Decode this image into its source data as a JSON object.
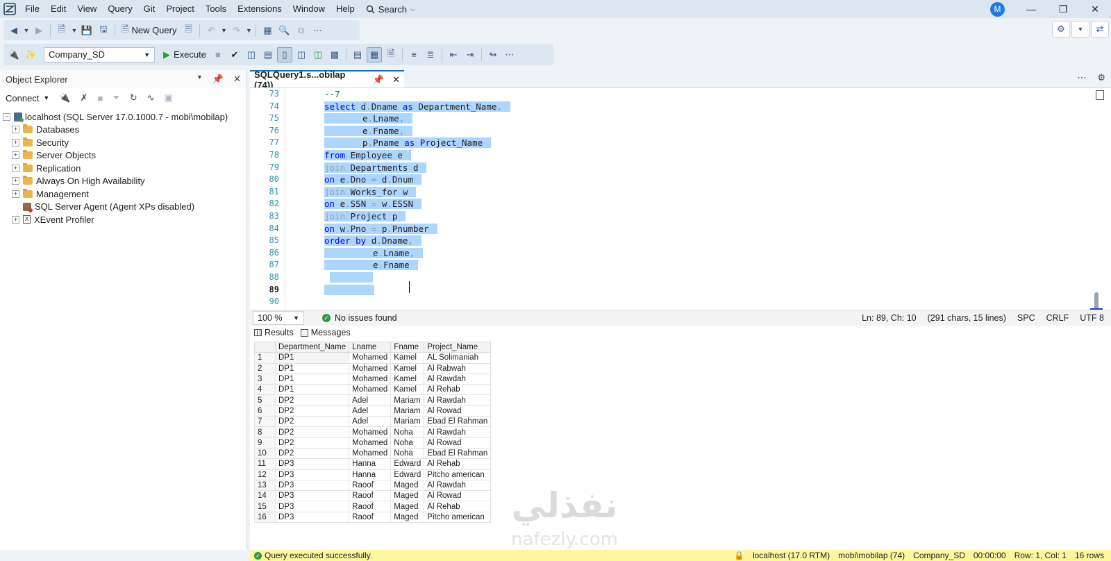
{
  "menu": [
    "File",
    "Edit",
    "View",
    "Query",
    "Git",
    "Project",
    "Tools",
    "Extensions",
    "Window",
    "Help"
  ],
  "search_label": "Search",
  "avatar_initial": "M",
  "toolbar": {
    "new_query_label": "New Query",
    "database": "Company_SD",
    "execute_label": "Execute"
  },
  "object_explorer": {
    "title": "Object Explorer",
    "connect_label": "Connect",
    "server": "localhost (SQL Server 17.0.1000.7 - mobi\\mobilap)",
    "nodes": [
      "Databases",
      "Security",
      "Server Objects",
      "Replication",
      "Always On High Availability",
      "Management",
      "SQL Server Agent (Agent XPs disabled)",
      "XEvent Profiler"
    ]
  },
  "editor": {
    "tab_title": "SQLQuery1.s...obilap (74))",
    "line_numbers": [
      "73",
      "74",
      "75",
      "76",
      "77",
      "78",
      "79",
      "80",
      "81",
      "82",
      "83",
      "84",
      "85",
      "86",
      "87",
      "88",
      "89",
      "90"
    ],
    "current_line": "89",
    "code": {
      "l73": "--7",
      "l74": [
        "select",
        " d",
        ".",
        "Dname ",
        "as",
        " Department_Name",
        ","
      ],
      "l75": [
        "e",
        ".",
        "Lname",
        ","
      ],
      "l76": [
        "e",
        ".",
        "Fname",
        ","
      ],
      "l77": [
        "p",
        ".",
        "Pname ",
        "as",
        " Project_Name"
      ],
      "l78": [
        "from",
        " Employee e"
      ],
      "l79": [
        "join",
        " Departments d"
      ],
      "l80": [
        "on",
        " e",
        ".",
        "Dno ",
        "=",
        " d",
        ".",
        "Dnum"
      ],
      "l81": [
        "join",
        " Works_for w"
      ],
      "l82": [
        "on",
        " e",
        ".",
        "SSN ",
        "=",
        " w",
        ".",
        "ESSN"
      ],
      "l83": [
        "join",
        " Project p"
      ],
      "l84": [
        "on",
        " w",
        ".",
        "Pno ",
        "=",
        " p",
        ".",
        "Pnumber"
      ],
      "l85": [
        "order by",
        " d",
        ".",
        "Dname",
        ","
      ],
      "l86": [
        "e",
        ".",
        "Lname",
        ","
      ],
      "l87": [
        "e",
        ".",
        "Fname"
      ]
    }
  },
  "editor_status": {
    "zoom": "100 %",
    "issues": "No issues found",
    "position": "Ln: 89, Ch: 10",
    "chars": "(291 chars, 15 lines)",
    "whitespace": "SPC",
    "line_ending": "CRLF",
    "encoding": "UTF 8"
  },
  "results": {
    "tabs": [
      "Results",
      "Messages"
    ],
    "columns": [
      "Department_Name",
      "Lname",
      "Fname",
      "Project_Name"
    ],
    "rows": [
      [
        "1",
        "DP1",
        "Mohamed",
        "Kamel",
        "AL Solimaniah"
      ],
      [
        "2",
        "DP1",
        "Mohamed",
        "Kamel",
        "Al Rabwah"
      ],
      [
        "3",
        "DP1",
        "Mohamed",
        "Kamel",
        "Al Rawdah"
      ],
      [
        "4",
        "DP1",
        "Mohamed",
        "Kamel",
        "Al Rehab"
      ],
      [
        "5",
        "DP2",
        "Adel",
        "Mariam",
        "Al Rawdah"
      ],
      [
        "6",
        "DP2",
        "Adel",
        "Mariam",
        "Al Rowad"
      ],
      [
        "7",
        "DP2",
        "Adel",
        "Mariam",
        "Ebad El Rahman"
      ],
      [
        "8",
        "DP2",
        "Mohamed",
        "Noha",
        "Al Rawdah"
      ],
      [
        "9",
        "DP2",
        "Mohamed",
        "Noha",
        "Al Rowad"
      ],
      [
        "10",
        "DP2",
        "Mohamed",
        "Noha",
        "Ebad El Rahman"
      ],
      [
        "11",
        "DP3",
        "Hanna",
        "Edward",
        "Al Rehab"
      ],
      [
        "12",
        "DP3",
        "Hanna",
        "Edward",
        "Pitcho american"
      ],
      [
        "13",
        "DP3",
        "Raoof",
        "Maged",
        "Al Rawdah"
      ],
      [
        "14",
        "DP3",
        "Raoof",
        "Maged",
        "Al Rowad"
      ],
      [
        "15",
        "DP3",
        "Raoof",
        "Maged",
        "Al Rehab"
      ],
      [
        "16",
        "DP3",
        "Raoof",
        "Maged",
        "Pitcho american"
      ]
    ]
  },
  "status_bar": {
    "message": "Query executed successfully.",
    "server": "localhost (17.0 RTM)",
    "user": "mobi\\mobilap (74)",
    "database": "Company_SD",
    "elapsed": "00:00:00",
    "rows_col": "Row: 1, Col: 1",
    "row_count": "16 rows"
  },
  "watermark": {
    "arabic": "نفذلي",
    "latin": "nafezly.com"
  },
  "colors": {
    "accent": "#1f6fbf",
    "selection": "#add6ff",
    "keyword": "#0000ff",
    "comment": "#008000",
    "status_bar": "#fff59d"
  }
}
